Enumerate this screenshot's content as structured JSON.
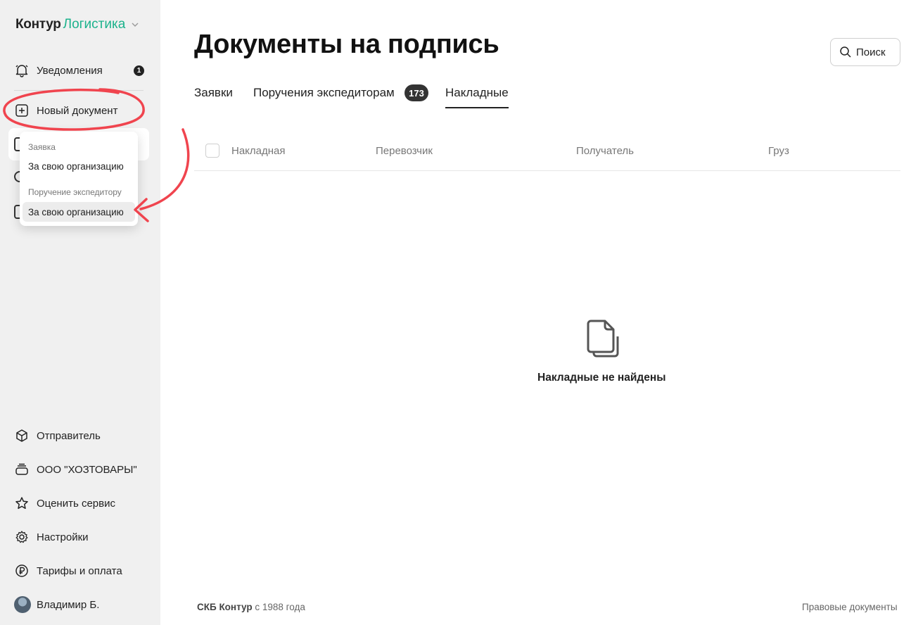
{
  "sidebar": {
    "logo": {
      "brand": "Контур",
      "product": "Логистика"
    },
    "notifications": {
      "label": "Уведомления",
      "count": "1"
    },
    "new_document": {
      "label": "Новый документ"
    },
    "bottom": {
      "sender": "Отправитель",
      "organization": "ООО \"ХОЗТОВАРЫ\"",
      "rate": "Оценить сервис",
      "settings": "Настройки",
      "tariffs": "Тарифы и оплата",
      "user": "Владимир Б."
    }
  },
  "dropdown": {
    "group1_header": "Заявка",
    "group1_item": "За свою организацию",
    "group2_header": "Поручение экспедитору",
    "group2_item": "За свою организацию"
  },
  "main": {
    "title": "Документы на подпись",
    "search_label": "Поиск",
    "tabs": [
      {
        "label": "Заявки"
      },
      {
        "label": "Поручения экспедиторам",
        "badge": "173"
      },
      {
        "label": "Накладные"
      }
    ],
    "table_headers": [
      "Накладная",
      "Перевозчик",
      "Получатель",
      "Груз"
    ],
    "empty_message": "Накладные не найдены"
  },
  "footer": {
    "company": "СКБ Контур",
    "since": "с 1988 года",
    "legal": "Правовые документы"
  },
  "colors": {
    "accent_green": "#1cb28c",
    "annotation_red": "#f0444e",
    "sidebar_bg": "#f0f0f0"
  }
}
